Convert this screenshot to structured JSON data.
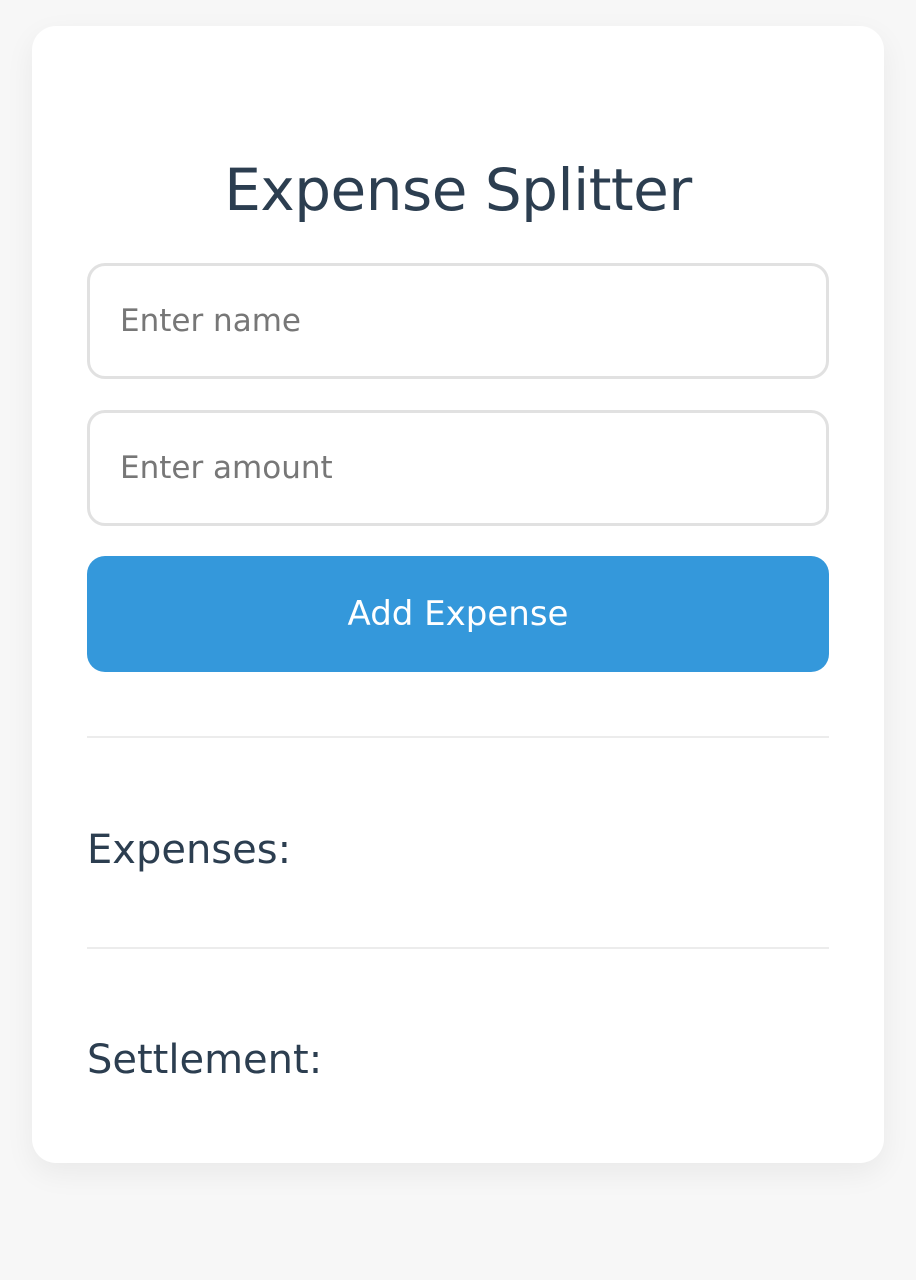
{
  "app": {
    "title": "Expense Splitter"
  },
  "form": {
    "name_placeholder": "Enter name",
    "name_value": "",
    "amount_placeholder": "Enter amount",
    "amount_value": "",
    "add_button_label": "Add Expense"
  },
  "sections": {
    "expenses_heading": "Expenses:",
    "expenses": [],
    "settlement_heading": "Settlement:",
    "settlements": []
  },
  "colors": {
    "background": "#f7f7f7",
    "card": "#ffffff",
    "accent": "#3498db",
    "heading_text": "#2c3e50",
    "input_border": "#e1e1e1",
    "placeholder_text": "#777777"
  }
}
